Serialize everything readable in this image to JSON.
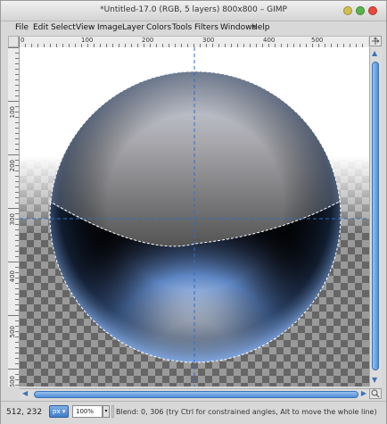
{
  "window": {
    "title": "*Untitled-17.0 (RGB, 5 layers) 800x800 – GIMP"
  },
  "menu": [
    {
      "label": "File",
      "key": "F"
    },
    {
      "label": "Edit",
      "key": "E"
    },
    {
      "label": "Select",
      "key": "S"
    },
    {
      "label": "View",
      "key": "V"
    },
    {
      "label": "Image",
      "key": "I"
    },
    {
      "label": "Layer",
      "key": "L"
    },
    {
      "label": "Colors",
      "key": "C"
    },
    {
      "label": "Tools",
      "key": "T"
    },
    {
      "label": "Filters",
      "key": "r"
    },
    {
      "label": "Windows",
      "key": "W"
    },
    {
      "label": "Help",
      "key": "H"
    }
  ],
  "rulers": {
    "horizontal": [
      "0",
      "100",
      "200",
      "300",
      "400",
      "500"
    ],
    "vertical": [
      "100",
      "200",
      "300",
      "400",
      "500",
      "600",
      "700"
    ]
  },
  "status": {
    "coords": "512, 232",
    "unit": "px",
    "zoom": "100%",
    "message": "Blend: 0, 306 (try Ctrl for constrained angles, Alt to move the whole line)"
  },
  "colors": {
    "accent": "#4f8fd8",
    "sphere_blue": "#c9dbff",
    "guide": "#2f6fc0"
  },
  "icons": {
    "navigate": "navigate-icon",
    "minimize": "minimize-icon",
    "maximize": "maximize-icon",
    "close": "close-icon",
    "scroll_up": "arrow-up-icon",
    "scroll_down": "arrow-down-icon",
    "scroll_left": "arrow-left-icon",
    "scroll_right": "arrow-right-icon",
    "zoom_to_fit": "zoom-icon"
  }
}
